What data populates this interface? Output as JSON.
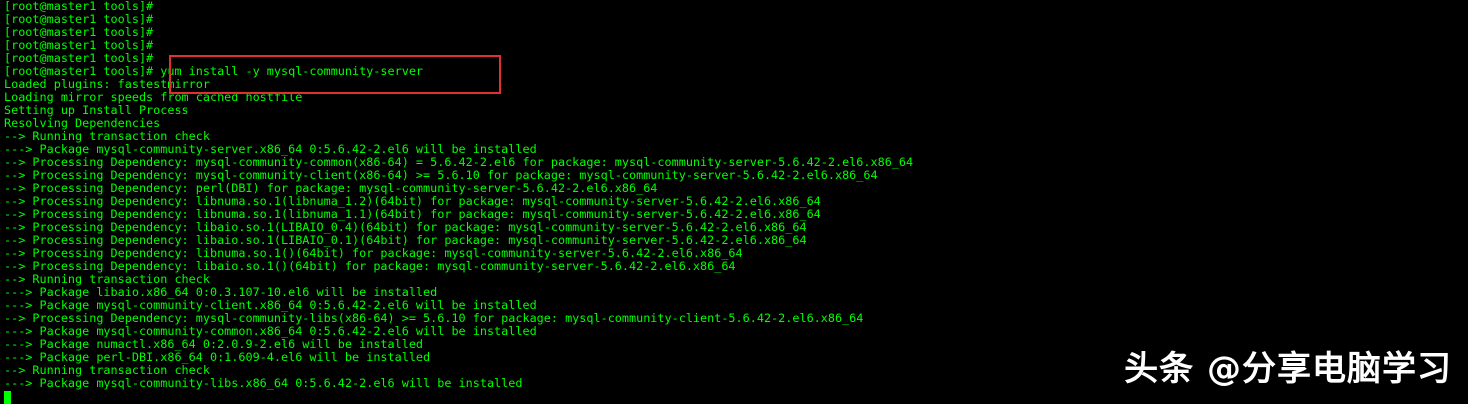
{
  "terminal": {
    "lines": [
      "[root@master1 tools]#",
      "[root@master1 tools]#",
      "[root@master1 tools]#",
      "[root@master1 tools]#",
      "[root@master1 tools]#",
      "[root@master1 tools]# yum install -y mysql-community-server",
      "Loaded plugins: fastestmirror",
      "Loading mirror speeds from cached hostfile",
      "Setting up Install Process",
      "Resolving Dependencies",
      "--> Running transaction check",
      "---> Package mysql-community-server.x86_64 0:5.6.42-2.el6 will be installed",
      "--> Processing Dependency: mysql-community-common(x86-64) = 5.6.42-2.el6 for package: mysql-community-server-5.6.42-2.el6.x86_64",
      "--> Processing Dependency: mysql-community-client(x86-64) >= 5.6.10 for package: mysql-community-server-5.6.42-2.el6.x86_64",
      "--> Processing Dependency: perl(DBI) for package: mysql-community-server-5.6.42-2.el6.x86_64",
      "--> Processing Dependency: libnuma.so.1(libnuma_1.2)(64bit) for package: mysql-community-server-5.6.42-2.el6.x86_64",
      "--> Processing Dependency: libnuma.so.1(libnuma_1.1)(64bit) for package: mysql-community-server-5.6.42-2.el6.x86_64",
      "--> Processing Dependency: libaio.so.1(LIBAIO_0.4)(64bit) for package: mysql-community-server-5.6.42-2.el6.x86_64",
      "--> Processing Dependency: libaio.so.1(LIBAIO_0.1)(64bit) for package: mysql-community-server-5.6.42-2.el6.x86_64",
      "--> Processing Dependency: libnuma.so.1()(64bit) for package: mysql-community-server-5.6.42-2.el6.x86_64",
      "--> Processing Dependency: libaio.so.1()(64bit) for package: mysql-community-server-5.6.42-2.el6.x86_64",
      "--> Running transaction check",
      "---> Package libaio.x86_64 0:0.3.107-10.el6 will be installed",
      "---> Package mysql-community-client.x86_64 0:5.6.42-2.el6 will be installed",
      "--> Processing Dependency: mysql-community-libs(x86-64) >= 5.6.10 for package: mysql-community-client-5.6.42-2.el6.x86_64",
      "---> Package mysql-community-common.x86_64 0:5.6.42-2.el6 will be installed",
      "---> Package numactl.x86_64 0:2.0.9-2.el6 will be installed",
      "---> Package perl-DBI.x86_64 0:1.609-4.el6 will be installed",
      "--> Running transaction check",
      "---> Package mysql-community-libs.x86_64 0:5.6.42-2.el6 will be installed"
    ]
  },
  "watermark": "头条 @分享电脑学习",
  "colors": {
    "background": "#000000",
    "text": "#00ff00",
    "highlight_border": "#e03030"
  }
}
